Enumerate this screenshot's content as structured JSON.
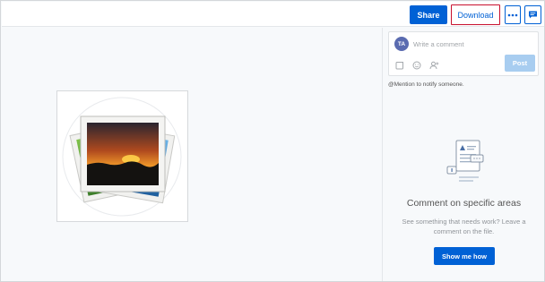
{
  "header": {
    "share_label": "Share",
    "download_label": "Download",
    "more_icon": "ellipsis-icon",
    "sidebar_icon": "comment-bubble-icon"
  },
  "preview": {
    "file_icon": "image-stack-icon"
  },
  "composer": {
    "avatar_initials": "TA",
    "placeholder": "Write a comment",
    "post_label": "Post",
    "tools": [
      "checkbox-icon",
      "emoji-icon",
      "add-person-icon"
    ]
  },
  "sidebar": {
    "mention_hint": "@Mention to notify someone.",
    "empty_title": "Comment on specific areas",
    "empty_desc": "See something that needs work? Leave a comment on the file.",
    "show_me_label": "Show me how"
  },
  "colors": {
    "primary": "#0061d5",
    "download_border": "#c8102e",
    "post_disabled": "#a8cdf0",
    "avatar": "#5a6bb0"
  }
}
